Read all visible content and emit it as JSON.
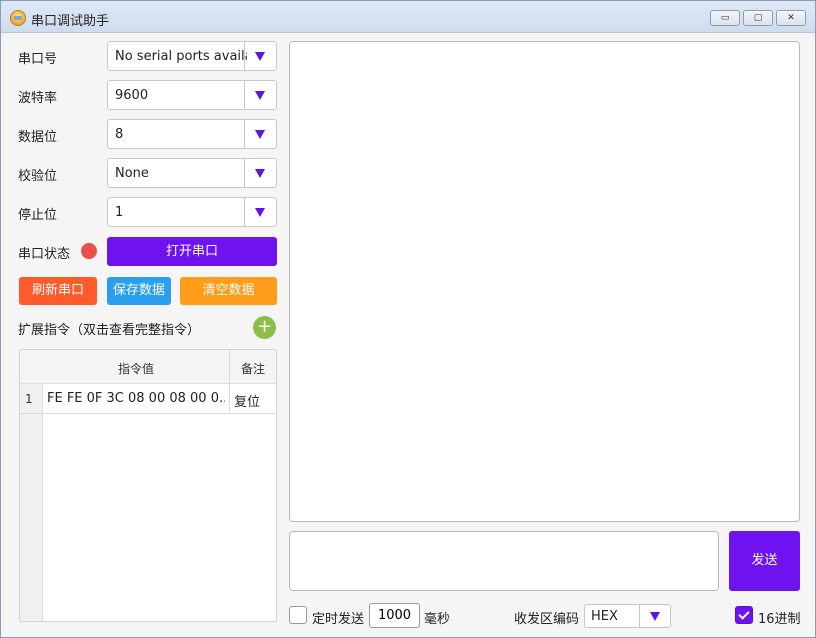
{
  "window": {
    "title": "串口调试助手",
    "minimize_symbol": "▭",
    "maximize_symbol": "▢",
    "close_symbol": "✕"
  },
  "settings": {
    "port_label": "串口号",
    "port_value": "No serial ports available",
    "baud_label": "波特率",
    "baud_value": "9600",
    "databits_label": "数据位",
    "databits_value": "8",
    "parity_label": "校验位",
    "parity_value": "None",
    "stopbits_label": "停止位",
    "stopbits_value": "1",
    "status_label": "串口状态",
    "status_color": "#e8504c"
  },
  "buttons": {
    "open_port": "打开串口",
    "refresh_port": "刷新串口",
    "save_data": "保存数据",
    "clear_data": "清空数据",
    "add": "+",
    "send": "发送"
  },
  "commands": {
    "title": "扩展指令（双击查看完整指令）",
    "columns": [
      "指令值",
      "备注"
    ],
    "rows": [
      {
        "index": "1",
        "command": "FE FE 0F 3C 08 00 08 00 0...",
        "note": "复位"
      }
    ]
  },
  "bottom": {
    "timer_label": "定时发送",
    "interval_value": "1000",
    "interval_unit": "毫秒",
    "encoding_label": "收发区编码",
    "encoding_value": "HEX",
    "hex_label": "16进制",
    "hex_checked": true
  },
  "colors": {
    "accent": "#6e12f0",
    "refresh": "#ff5a2a",
    "save": "#2a9ff0",
    "clear": "#ff9c1a",
    "add": "#8ac04a"
  }
}
